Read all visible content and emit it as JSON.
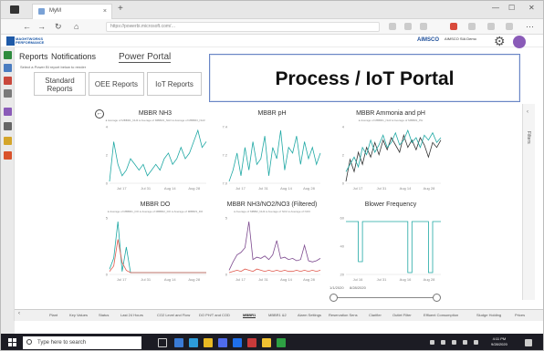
{
  "browser": {
    "tab_title": "MyM",
    "url": "https://powerbi.microsoft.com/…",
    "close": "×",
    "new_tab": "+"
  },
  "app": {
    "logo_text": "MAGHTWORKS PERFORMANCE",
    "user_logo": "AIMSCO",
    "user_name": "AIMSCO SIA Demo"
  },
  "portal_tabs": [
    "Reports",
    "Notifications",
    "Power Portal"
  ],
  "hint": "Select a Power BI report below to render",
  "report_buttons": [
    "Standard Reports",
    "OEE Reports",
    "IoT Reports"
  ],
  "banner": "Process / IoT Portal",
  "filters_label": "Filters",
  "colors": {
    "teal": "#1fa8a4",
    "dark": "#333333",
    "red": "#e05a4e",
    "purple": "#7d4a8f",
    "banner_border": "#6a86c6"
  },
  "chart_data": [
    {
      "type": "line",
      "title": "MBBR NH3",
      "legend": "● Average of MBBR1_NH3 ● Average of MBBR2_NH3 ● Average of MBBR3_NH3",
      "x_ticks": [
        "Jul 17",
        "Jul 31",
        "Aug 14",
        "Aug 28"
      ],
      "y_ticks": [
        "4",
        "2",
        "0"
      ],
      "series": [
        {
          "values": [
            0.2,
            0.9,
            0.5,
            0.3,
            0.4,
            0.6,
            0.5,
            0.4,
            0.5,
            0.3,
            0.4,
            0.5,
            0.4,
            0.6,
            0.7,
            0.5,
            0.6,
            0.8,
            0.6,
            0.7,
            0.9,
            1.1,
            0.8,
            0.9
          ]
        }
      ]
    },
    {
      "type": "line",
      "title": "MBBR pH",
      "legend": "",
      "x_ticks": [
        "Jul 17",
        "Jul 31",
        "Aug 14",
        "Aug 28"
      ],
      "y_ticks": [
        "7.4",
        "7.2",
        "7.0"
      ],
      "series": [
        {
          "values": [
            7.0,
            7.1,
            7.25,
            7.05,
            7.3,
            7.1,
            7.35,
            7.15,
            7.2,
            7.4,
            7.05,
            7.3,
            7.2,
            7.45,
            7.1,
            7.3,
            7.25,
            7.4,
            7.15,
            7.35,
            7.2,
            7.3,
            7.15,
            7.25
          ]
        }
      ]
    },
    {
      "type": "line",
      "title": "MBBR Ammonia and pH",
      "legend": "● Average of MBBR1_NH3 ● Average of MBBR1_PH",
      "x_ticks": [
        "Jul 17",
        "Jul 31",
        "Aug 14",
        "Aug 28"
      ],
      "y_ticks": [
        "4",
        "2",
        "0"
      ],
      "series": [
        {
          "values": [
            1.2,
            2.1,
            1.6,
            2.4,
            1.9,
            2.6,
            2.2,
            2.8,
            2.3,
            2.9,
            2.5,
            3.0,
            2.7,
            2.4,
            3.1,
            2.6,
            2.9,
            2.5,
            3.0,
            2.7,
            2.2,
            2.8,
            2.6,
            2.9
          ]
        },
        {
          "values": [
            1.6,
            1.9,
            2.2,
            1.8,
            2.6,
            2.3,
            2.9,
            2.4,
            2.7,
            3.1,
            2.6,
            2.8,
            3.2,
            2.7,
            2.9,
            3.3,
            2.8,
            3.0,
            2.6,
            3.1,
            2.9,
            3.2,
            2.8,
            3.0
          ]
        }
      ]
    },
    {
      "type": "line",
      "title": "MBBR DO",
      "legend": "● Average of MBBR1_DO ● Average of MBBR2_DO ● Average of MBBR3_DO",
      "x_ticks": [
        "Jul 17",
        "Jul 31",
        "Aug 14",
        "Aug 28"
      ],
      "y_ticks": [
        "5",
        "0"
      ],
      "series": [
        {
          "values": [
            0.5,
            1.5,
            4.8,
            0.3,
            2.5,
            0.2,
            0.2,
            0.2,
            0.2,
            0.2,
            0.2,
            0.2,
            0.2,
            0.2,
            0.2,
            0.2,
            0.2,
            0.2,
            0.2,
            0.2,
            0.2,
            0.2,
            0.2,
            0.2
          ]
        },
        {
          "values": [
            0.3,
            0.8,
            3.2,
            1.1,
            0.4,
            0.2,
            0.2,
            0.2,
            0.2,
            0.2,
            0.2,
            0.2,
            0.2,
            0.2,
            0.2,
            0.2,
            0.2,
            0.2,
            0.2,
            0.2,
            0.2,
            0.2,
            0.2,
            0.2
          ]
        }
      ]
    },
    {
      "type": "line",
      "title": "MBBR NH3/NO2/NO3 (Filtered)",
      "legend": "● Average of MBBR_NH3 ● Average of NO2 ● Average of NO3",
      "x_ticks": [
        "Jul 17",
        "Jul 31",
        "Aug 14",
        "Aug 28"
      ],
      "y_ticks": [
        "5",
        "0"
      ],
      "series": [
        {
          "values": [
            0.5,
            1.2,
            1.8,
            2.0,
            2.4,
            4.6,
            1.4,
            1.6,
            1.5,
            1.7,
            1.4,
            1.8,
            3.0,
            1.5,
            1.6,
            1.4,
            1.5,
            1.3,
            1.4,
            2.6,
            1.3,
            1.2,
            1.3,
            1.5
          ]
        },
        {
          "values": [
            0.3,
            0.4,
            0.5,
            0.4,
            0.6,
            0.5,
            0.4,
            0.6,
            0.5,
            0.4,
            0.5,
            0.4,
            0.5,
            0.4,
            0.5,
            0.4,
            0.4,
            0.5,
            0.4,
            0.5,
            0.4,
            0.5,
            0.4,
            0.5
          ]
        }
      ]
    },
    {
      "type": "line",
      "title": "Blower Frequency",
      "legend": "",
      "x_ticks": [
        "Jul 16",
        "Jul 31",
        "Aug 16",
        "Aug 28"
      ],
      "y_ticks": [
        "60",
        "40",
        "20"
      ],
      "series": [
        {
          "values": [
            52,
            52,
            52,
            30,
            52,
            52,
            52,
            52,
            52,
            52,
            52,
            52,
            52,
            52,
            52,
            24,
            52,
            52,
            52,
            52,
            24,
            52,
            52,
            52
          ]
        }
      ]
    }
  ],
  "slider_labels": [
    "1/1/2020",
    "8/28/2020"
  ],
  "page_tabs": [
    "Plant",
    "Key Values",
    "Status",
    "Last 24 Hours",
    "CO2 Level and Flow",
    "DO PH/T and COD",
    "MBBR1",
    "MBBR1 &2",
    "Alarm Settings",
    "Reservation Sens",
    "Clarifier",
    "Outlet Filter",
    "Effluent Consumption",
    "Sludge Holding",
    "Prices"
  ],
  "active_page_tab": "MBBR1",
  "taskbar": {
    "search_placeholder": "Type here to search",
    "time": "4:11 PM",
    "date": "9/28/2020"
  }
}
